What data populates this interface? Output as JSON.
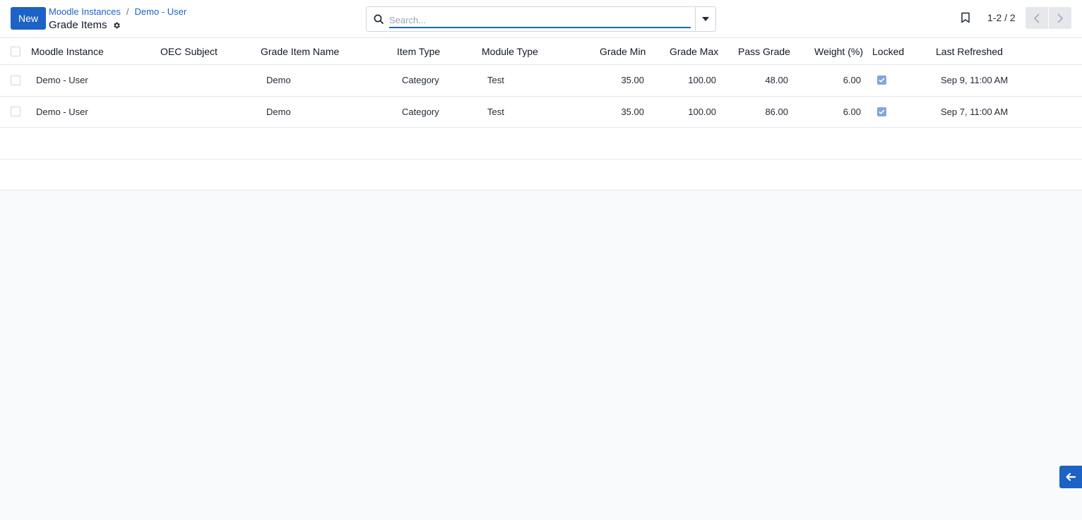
{
  "toolbar": {
    "new_label": "New",
    "breadcrumb": [
      "Moodle Instances",
      "Demo - User"
    ],
    "breadcrumb_separator": "/",
    "title": "Grade Items"
  },
  "search": {
    "placeholder": "Search..."
  },
  "pager": {
    "value": "1-2 / 2"
  },
  "table": {
    "columns": [
      "Moodle Instance",
      "OEC Subject",
      "Grade Item Name",
      "Item Type",
      "Module Type",
      "Grade Min",
      "Grade Max",
      "Pass Grade",
      "Weight (%)",
      "Locked",
      "Last Refreshed"
    ],
    "rows": [
      {
        "moodle_instance": "Demo - User",
        "oec_subject": "",
        "grade_item_name": "Demo",
        "item_type": "Category",
        "module_type": "Test",
        "grade_min": "35.00",
        "grade_max": "100.00",
        "pass_grade": "48.00",
        "weight": "6.00",
        "locked": true,
        "last_refreshed": "Sep 9, 11:00 AM"
      },
      {
        "moodle_instance": "Demo - User",
        "oec_subject": "",
        "grade_item_name": "Demo",
        "item_type": "Category",
        "module_type": "Test",
        "grade_min": "35.00",
        "grade_max": "100.00",
        "pass_grade": "86.00",
        "weight": "6.00",
        "locked": true,
        "last_refreshed": "Sep 7, 11:00 AM"
      }
    ]
  },
  "colors": {
    "primary": "#1d62c5",
    "locked_check": "#7fa7e0"
  }
}
